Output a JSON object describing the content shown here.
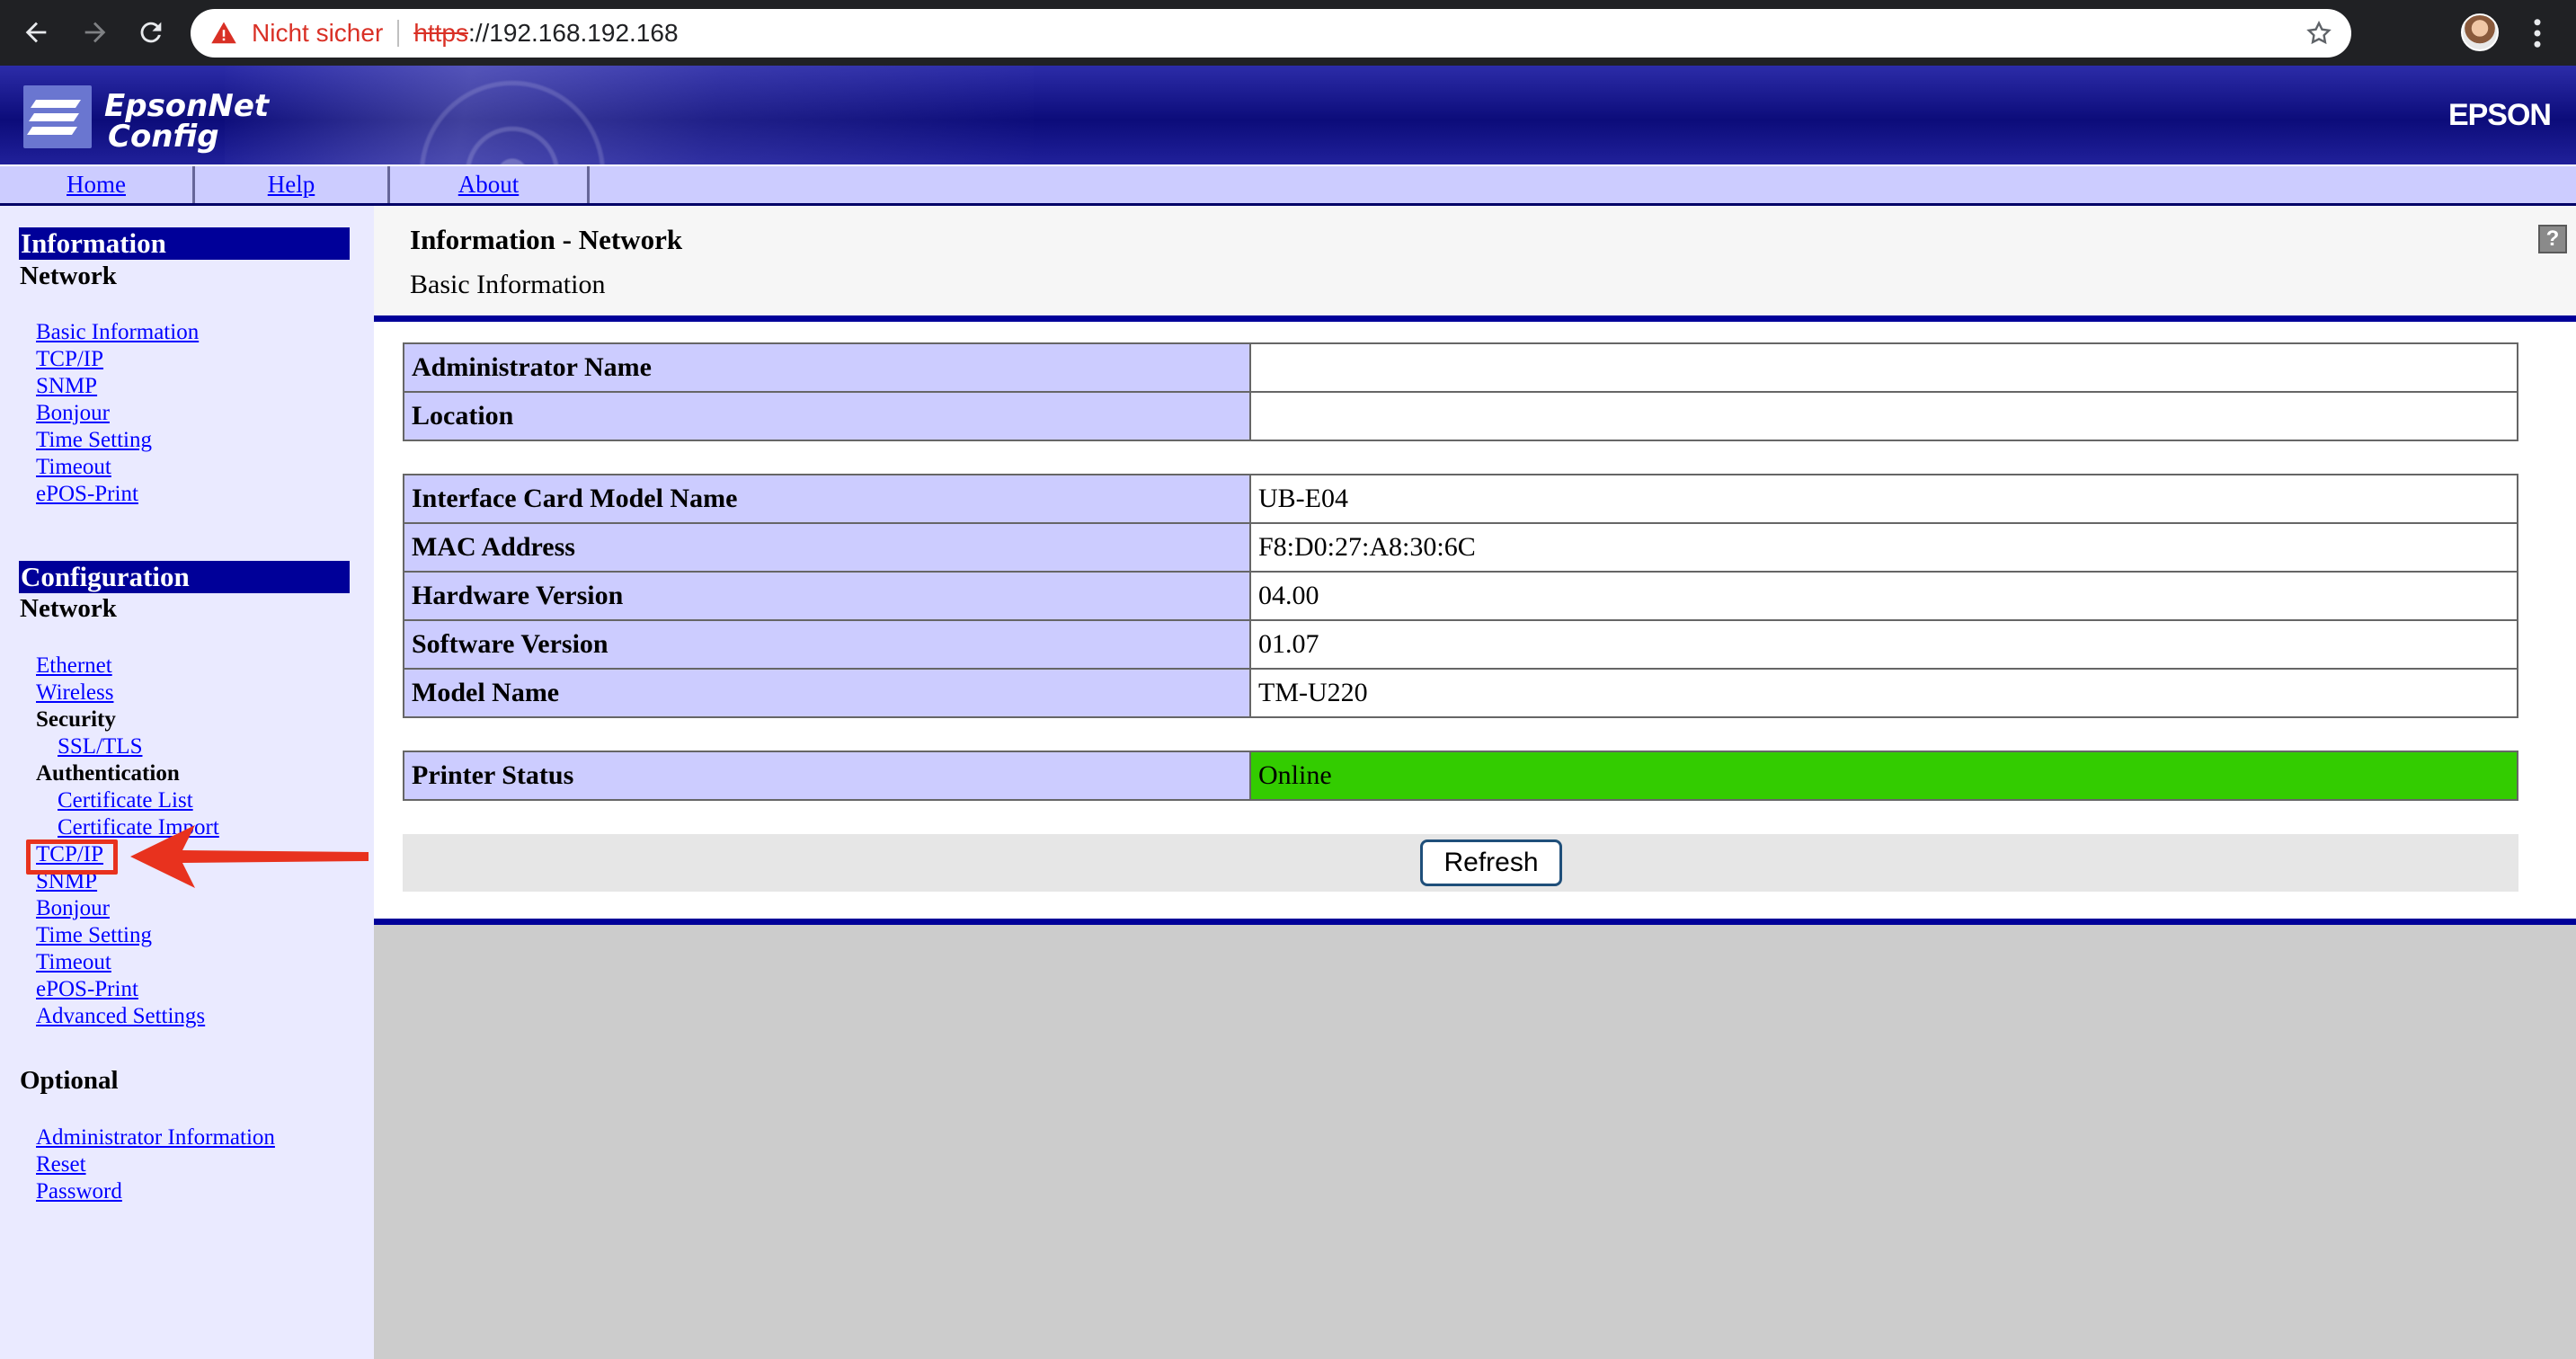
{
  "browser": {
    "security_text": "Nicht sicher",
    "url_scheme": "https",
    "url_rest": "://192.168.192.168"
  },
  "header": {
    "logo_line1": "EpsonNet",
    "logo_line2": "Config",
    "brand": "EPSON"
  },
  "menu": {
    "home": "Home",
    "help": "Help",
    "about": "About"
  },
  "sidebar": {
    "information": {
      "heading": "Information",
      "subheading": "Network",
      "links": [
        "Basic Information",
        "TCP/IP",
        "SNMP",
        "Bonjour",
        "Time Setting",
        "Timeout",
        "ePOS-Print"
      ]
    },
    "configuration": {
      "heading": "Configuration",
      "subheading": "Network",
      "ethernet": "Ethernet",
      "wireless": "Wireless",
      "security_label": "Security",
      "ssl_tls": "SSL/TLS",
      "authentication_label": "Authentication",
      "certificate_list": "Certificate List",
      "certificate_import": "Certificate Import",
      "links": [
        "TCP/IP",
        "SNMP",
        "Bonjour",
        "Time Setting",
        "Timeout",
        "ePOS-Print",
        "Advanced Settings"
      ]
    },
    "optional": {
      "heading": "Optional",
      "links": [
        "Administrator Information",
        "Reset",
        "Password"
      ]
    }
  },
  "main": {
    "title": "Information - Network",
    "subtitle": "Basic Information",
    "help_icon_glyph": "?",
    "admin_table": [
      {
        "label": "Administrator Name",
        "value": ""
      },
      {
        "label": "Location",
        "value": ""
      }
    ],
    "device_table": [
      {
        "label": "Interface Card Model Name",
        "value": "UB-E04"
      },
      {
        "label": "MAC Address",
        "value": "F8:D0:27:A8:30:6C"
      },
      {
        "label": "Hardware Version",
        "value": "04.00"
      },
      {
        "label": "Software Version",
        "value": "01.07"
      },
      {
        "label": "Model Name",
        "value": "TM-U220"
      }
    ],
    "status_table": [
      {
        "label": "Printer Status",
        "value": "Online"
      }
    ],
    "refresh_label": "Refresh"
  },
  "colors": {
    "accent": "#000099",
    "table_key_bg": "#ccccff",
    "online": "#33cc00",
    "annotation": "#e8321e"
  }
}
